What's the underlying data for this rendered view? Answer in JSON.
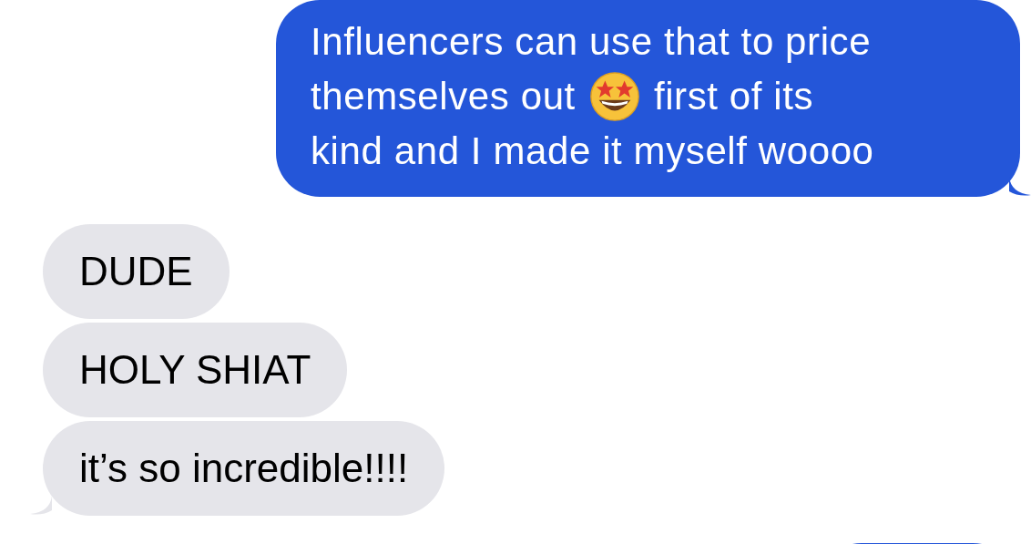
{
  "messages": [
    {
      "kind": "sent",
      "lines": [
        [
          {
            "kind": "text",
            "text": "Influencers can use that to price"
          }
        ],
        [
          {
            "kind": "text",
            "text": "themselves out"
          },
          {
            "kind": "emoji"
          },
          {
            "kind": "text",
            "text": "first of its"
          }
        ],
        [
          {
            "kind": "text",
            "text": "kind and I made it myself woooo"
          }
        ]
      ],
      "tail": true
    },
    {
      "kind": "received",
      "text": "DUDE",
      "tail": false
    },
    {
      "kind": "received",
      "text": "HOLY SHIAT",
      "tail": false
    },
    {
      "kind": "received",
      "text": "it’s so incredible!!!!",
      "tail": true
    },
    {
      "kind": "sent",
      "tail": false
    }
  ]
}
